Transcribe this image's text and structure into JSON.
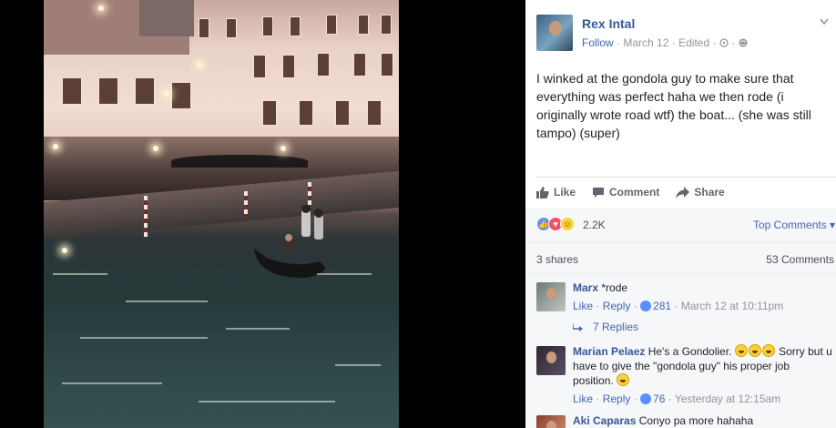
{
  "post": {
    "author": "Rex Intal",
    "follow_label": "Follow",
    "date": "March 12",
    "edited": "Edited",
    "text": "I winked at the gondola guy to make sure that everything was perfect haha we then rode (i originally wrote road wtf) the boat... (she was still tampo) (super)"
  },
  "actions": {
    "like": "Like",
    "comment": "Comment",
    "share": "Share"
  },
  "stats": {
    "reactions": "2.2K",
    "top_comments": "Top Comments",
    "shares": "3 shares",
    "comments": "53 Comments"
  },
  "comments": [
    {
      "name": "Marx",
      "text": "*rode",
      "like": "Like",
      "reply": "Reply",
      "likes": "281",
      "time": "March 12 at 10:11pm",
      "replies": "7 Replies"
    },
    {
      "name": "Marian Pelaez",
      "text_a": "He's a Gondolier.",
      "text_b": "Sorry but u have to give the \"gondola guy\" his proper job position.",
      "like": "Like",
      "reply": "Reply",
      "likes": "76",
      "time": "Yesterday at 12:15am"
    },
    {
      "name": "Aki Caparas",
      "text": "Conyo pa more hahaha"
    }
  ],
  "colors": {
    "link": "#365899",
    "accent": "#4267b2",
    "meta": "#90949c",
    "like_blue": "#5890ff",
    "love_red": "#f25268",
    "haha_yellow": "#fcd03b"
  },
  "icons": [
    "chevron-down-icon",
    "globe-icon",
    "like-thumb-icon",
    "comment-bubble-icon",
    "share-arrow-icon",
    "reply-arrow-icon"
  ]
}
